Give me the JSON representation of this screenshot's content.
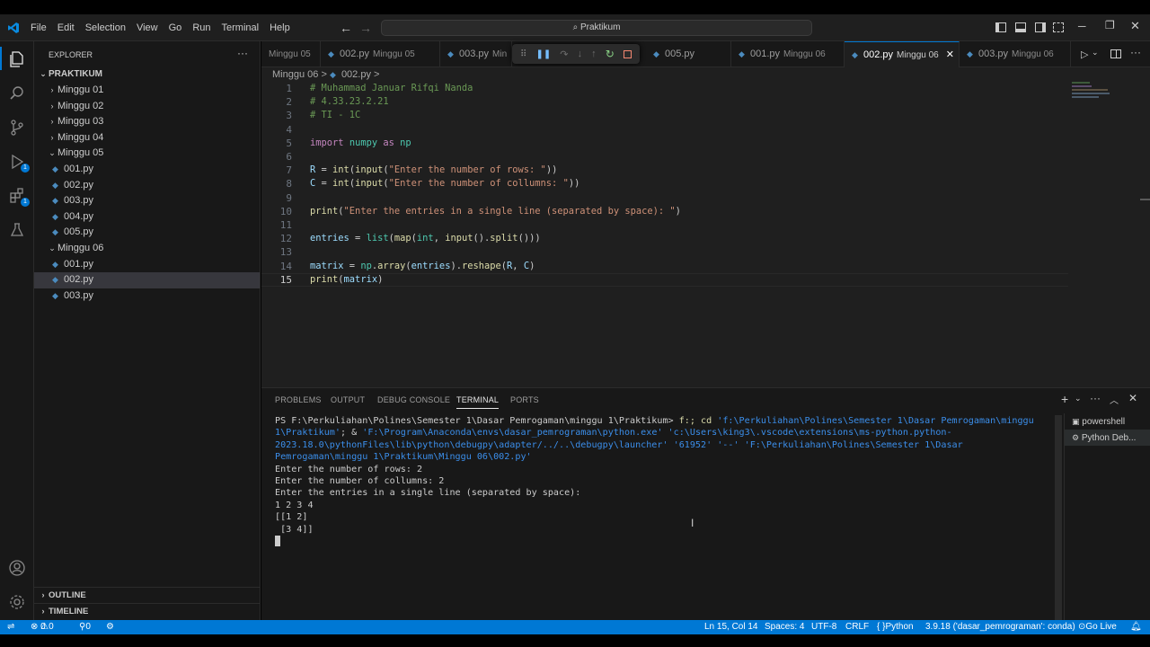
{
  "menu": [
    "File",
    "Edit",
    "Selection",
    "View",
    "Go",
    "Run",
    "Terminal",
    "Help"
  ],
  "command_center": "Praktikum",
  "explorer": {
    "header": "EXPLORER",
    "root": "PRAKTIKUM",
    "folders_closed": [
      "Minggu 01",
      "Minggu 02",
      "Minggu 03",
      "Minggu 04"
    ],
    "minggu05": {
      "label": "Minggu 05",
      "files": [
        "001.py",
        "002.py",
        "003.py",
        "004.py",
        "005.py"
      ]
    },
    "minggu06": {
      "label": "Minggu 06",
      "files": [
        "001.py",
        "002.py",
        "003.py"
      ]
    },
    "outline": "OUTLINE",
    "timeline": "TIMELINE"
  },
  "badges": {
    "debug": "1",
    "extensions": "1"
  },
  "tabs": [
    {
      "name": "",
      "desc": "Minggu 05"
    },
    {
      "name": "002.py",
      "desc": "Minggu 05"
    },
    {
      "name": "003.py",
      "desc": "Min"
    },
    {
      "name": "005.py",
      "desc": ""
    },
    {
      "name": "001.py",
      "desc": "Minggu 06"
    },
    {
      "name": "002.py",
      "desc": "Minggu 06"
    },
    {
      "name": "003.py",
      "desc": "Minggu 06"
    }
  ],
  "breadcrumb": {
    "folder": "Minggu 06",
    "file": "002.py",
    "sep": ">"
  },
  "editor": {
    "line_numbers": [
      "1",
      "2",
      "3",
      "4",
      "5",
      "6",
      "7",
      "8",
      "9",
      "10",
      "11",
      "12",
      "13",
      "14",
      "15"
    ],
    "current_line": 15
  },
  "code": {
    "l1": "# Muhammad Januar Rifqi Nanda",
    "l2": "# 4.33.23.2.21",
    "l3": "# TI - 1C",
    "l5_import": "import",
    "l5_mod": "numpy",
    "l5_as": "as",
    "l5_alias": "np",
    "l7_var": "R",
    "l7_int": "int",
    "l7_input": "input",
    "l7_str": "\"Enter the number of rows: \"",
    "l8_var": "C",
    "l8_str": "\"Enter the number of collumns: \"",
    "l10_print": "print",
    "l10_str": "\"Enter the entries in a single line (separated by space): \"",
    "l12_var": "entries",
    "l12_list": "list",
    "l12_map": "map",
    "l12_split": "split",
    "l14_var": "matrix",
    "l14_np": "np",
    "l14_array": "array",
    "l14_reshape": "reshape",
    "l15_print": "print"
  },
  "panel": {
    "tabs": [
      "PROBLEMS",
      "OUTPUT",
      "DEBUG CONSOLE",
      "TERMINAL",
      "PORTS"
    ],
    "active_tab": "TERMINAL",
    "terminals": [
      "powershell",
      "Python Deb..."
    ]
  },
  "terminal": {
    "prompt": "PS F:\\Perkuliahan\\Polines\\Semester 1\\Dasar Pemrogaman\\minggu 1\\Praktikum> ",
    "cmd1": "f:; cd",
    "str1": "'f:\\Perkuliahan\\Polines\\Semester 1\\Dasar Pemrogaman\\minggu 1\\Praktikum'",
    "mid1": "; & ",
    "str2": "'F:\\Program\\Anaconda\\envs\\dasar_pemrograman\\python.exe' 'c:\\Users\\king3\\.vscode\\extensions\\ms-python.python-2023.18.0\\pythonFiles\\lib\\python\\debugpy\\adapter/../..\\debugpy\\launcher' '61952' '--' 'F:\\Perkuliahan\\Polines\\Semester 1\\Dasar Pemrogaman\\minggu 1\\Praktikum\\Minggu 06\\002.py'",
    "out": [
      "Enter the number of rows: 2",
      "Enter the number of collumns: 2",
      "Enter the entries in a single line (separated by space):",
      "1 2 3 4",
      "[[1 2]",
      " [3 4]]"
    ]
  },
  "status": {
    "errors": "0",
    "warnings": "0",
    "ports": "0",
    "position": "Ln 15, Col 14",
    "spaces": "Spaces: 4",
    "encoding": "UTF-8",
    "eol": "CRLF",
    "language": "Python",
    "interpreter": "3.9.18 ('dasar_pemrograman': conda)",
    "golive": "Go Live"
  },
  "colors": {
    "accent": "#0078d4",
    "statusbar": "#0078d4"
  }
}
